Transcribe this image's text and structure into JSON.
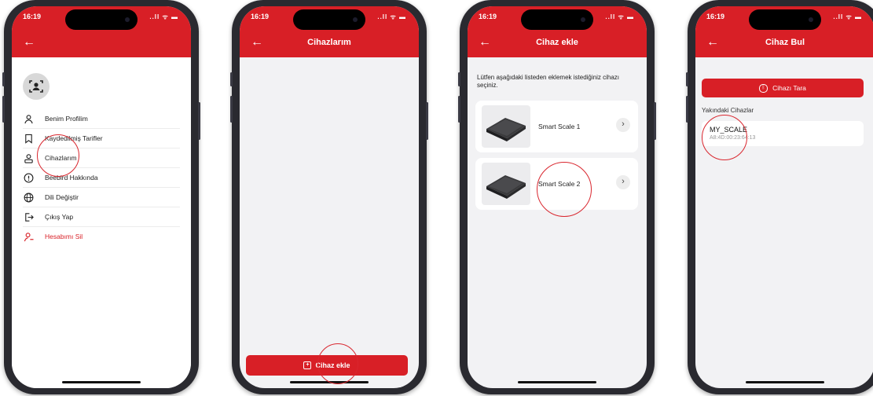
{
  "status": {
    "time": "16:19",
    "icons": "..ll ᯤ ▬"
  },
  "screen1": {
    "menu": [
      {
        "label": "Benim Profilim",
        "icon": "user-icon",
        "danger": false
      },
      {
        "label": "Kaydedilmiş Tarifler",
        "icon": "bookmark-icon",
        "danger": false
      },
      {
        "label": "Cihazlarım",
        "icon": "devices-icon",
        "danger": false
      },
      {
        "label": "Beebird Hakkında",
        "icon": "info-icon",
        "danger": false
      },
      {
        "label": "Dili Değiştir",
        "icon": "globe-icon",
        "danger": false
      },
      {
        "label": "Çıkış Yap",
        "icon": "logout-icon",
        "danger": false
      },
      {
        "label": "Hesabımı Sil",
        "icon": "delete-user-icon",
        "danger": true
      }
    ]
  },
  "screen2": {
    "title": "Cihazlarım",
    "add_button": "Cihaz ekle"
  },
  "screen3": {
    "title": "Cihaz ekle",
    "instruction": "Lütfen aşağıdaki listeden eklemek istediğiniz cihazı seçiniz.",
    "devices": [
      {
        "name": "Smart Scale 1"
      },
      {
        "name": "Smart Scale 2"
      }
    ]
  },
  "screen4": {
    "title": "Cihaz Bul",
    "scan_button": "Cihazı Tara",
    "section_label": "Yakındaki Cihazlar",
    "device": {
      "name": "MY_SCALE",
      "address": "A8:4D:00:23:64:13"
    }
  },
  "colors": {
    "brand_red": "#d81f26",
    "screen_bg": "#f2f2f4"
  }
}
